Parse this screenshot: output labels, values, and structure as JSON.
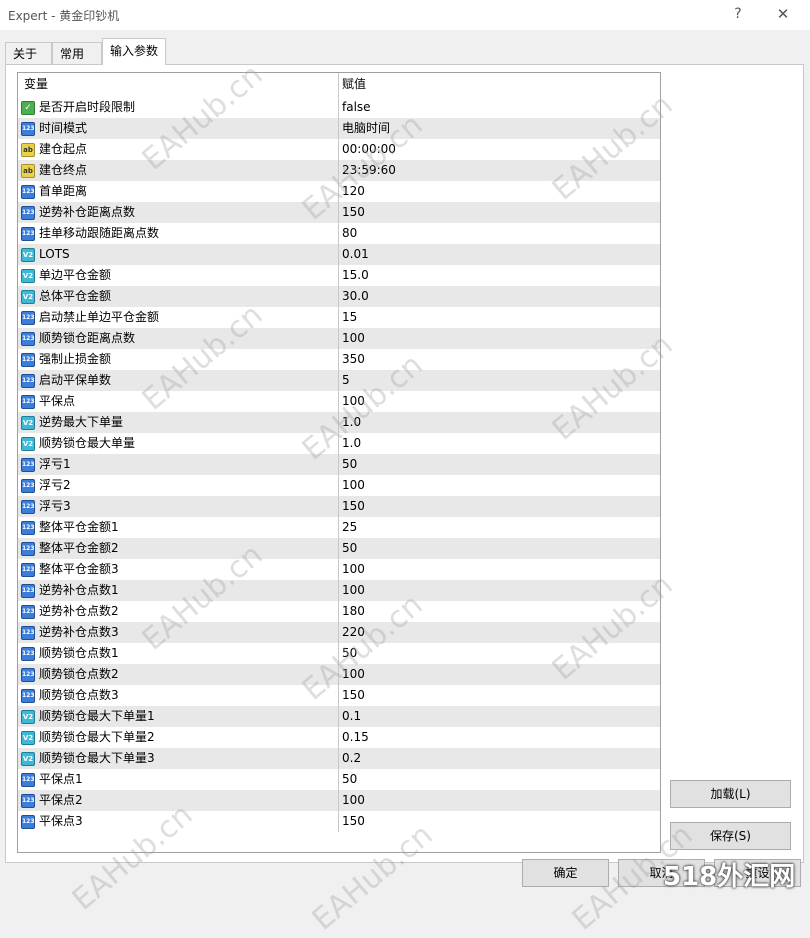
{
  "window": {
    "title": "Expert - 黄金印钞机",
    "help_icon": "?",
    "close_icon": "✕"
  },
  "tabs": [
    "关于",
    "常用",
    "输入参数"
  ],
  "table": {
    "headers": [
      "变量",
      "赋值"
    ],
    "rows": [
      {
        "icon": "bool",
        "name": "是否开启时段限制",
        "value": "false"
      },
      {
        "icon": "int",
        "name": "时间模式",
        "value": "电脑时间"
      },
      {
        "icon": "str",
        "name": "建仓起点",
        "value": "00:00:00"
      },
      {
        "icon": "str",
        "name": "建仓终点",
        "value": "23:59:60"
      },
      {
        "icon": "int",
        "name": "首单距离",
        "value": "120"
      },
      {
        "icon": "int",
        "name": "逆势补仓距离点数",
        "value": "150"
      },
      {
        "icon": "int",
        "name": "挂单移动跟随距离点数",
        "value": "80"
      },
      {
        "icon": "dbl",
        "name": "LOTS",
        "value": "0.01"
      },
      {
        "icon": "dbl",
        "name": "单边平仓金额",
        "value": "15.0"
      },
      {
        "icon": "dbl",
        "name": "总体平仓金额",
        "value": "30.0"
      },
      {
        "icon": "int",
        "name": "启动禁止单边平仓金额",
        "value": "15"
      },
      {
        "icon": "int",
        "name": "顺势锁仓距离点数",
        "value": "100"
      },
      {
        "icon": "int",
        "name": "强制止损金额",
        "value": "350"
      },
      {
        "icon": "int",
        "name": "启动平保单数",
        "value": "5"
      },
      {
        "icon": "int",
        "name": "平保点",
        "value": "100"
      },
      {
        "icon": "dbl",
        "name": "逆势最大下单量",
        "value": "1.0"
      },
      {
        "icon": "dbl",
        "name": "顺势锁仓最大单量",
        "value": "1.0"
      },
      {
        "icon": "int",
        "name": "浮亏1",
        "value": "50"
      },
      {
        "icon": "int",
        "name": "浮亏2",
        "value": "100"
      },
      {
        "icon": "int",
        "name": "浮亏3",
        "value": "150"
      },
      {
        "icon": "int",
        "name": "整体平仓金额1",
        "value": "25"
      },
      {
        "icon": "int",
        "name": "整体平仓金额2",
        "value": "50"
      },
      {
        "icon": "int",
        "name": "整体平仓金额3",
        "value": "100"
      },
      {
        "icon": "int",
        "name": "逆势补仓点数1",
        "value": "100"
      },
      {
        "icon": "int",
        "name": "逆势补仓点数2",
        "value": "180"
      },
      {
        "icon": "int",
        "name": "逆势补仓点数3",
        "value": "220"
      },
      {
        "icon": "int",
        "name": "顺势锁仓点数1",
        "value": "50"
      },
      {
        "icon": "int",
        "name": "顺势锁仓点数2",
        "value": "100"
      },
      {
        "icon": "int",
        "name": "顺势锁仓点数3",
        "value": "150"
      },
      {
        "icon": "dbl",
        "name": "顺势锁仓最大下单量1",
        "value": "0.1"
      },
      {
        "icon": "dbl",
        "name": "顺势锁仓最大下单量2",
        "value": "0.15"
      },
      {
        "icon": "dbl",
        "name": "顺势锁仓最大下单量3",
        "value": "0.2"
      },
      {
        "icon": "int",
        "name": "平保点1",
        "value": "50"
      },
      {
        "icon": "int",
        "name": "平保点2",
        "value": "100"
      },
      {
        "icon": "int",
        "name": "平保点3",
        "value": "150"
      }
    ]
  },
  "icon_glyphs": {
    "bool": "✓",
    "int": "123",
    "str": "ab",
    "dbl": "V2"
  },
  "buttons": {
    "load": "加载(L)",
    "save": "保存(S)",
    "ok": "确定",
    "cancel": "取消",
    "reset": "重设"
  },
  "watermark_text": "EAHub.cn",
  "corner_logo": "518外汇网"
}
